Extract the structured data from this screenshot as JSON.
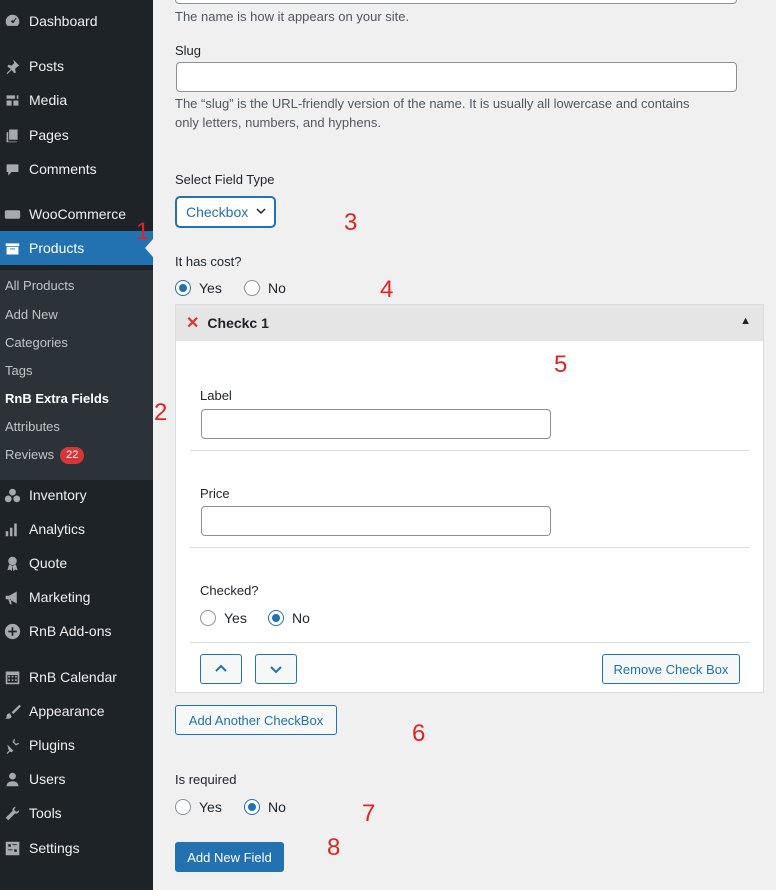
{
  "sidebar": {
    "menu": [
      {
        "label": "Dashboard",
        "icon": "dashboard-icon"
      },
      {
        "label": "Posts",
        "icon": "pin-icon"
      },
      {
        "label": "Media",
        "icon": "media-icon"
      },
      {
        "label": "Pages",
        "icon": "pages-icon"
      },
      {
        "label": "Comments",
        "icon": "comment-icon"
      },
      {
        "label": "WooCommerce",
        "icon": "woo-icon"
      },
      {
        "label": "Products",
        "icon": "archive-icon"
      },
      {
        "label": "Inventory",
        "icon": "inventory-icon"
      },
      {
        "label": "Analytics",
        "icon": "bar-chart-icon"
      },
      {
        "label": "Quote",
        "icon": "award-icon"
      },
      {
        "label": "Marketing",
        "icon": "megaphone-icon"
      },
      {
        "label": "RnB Add-ons",
        "icon": "plus-circle-icon"
      },
      {
        "label": "RnB Calendar",
        "icon": "calendar-icon"
      },
      {
        "label": "Appearance",
        "icon": "brush-icon"
      },
      {
        "label": "Plugins",
        "icon": "plug-icon"
      },
      {
        "label": "Users",
        "icon": "user-icon"
      },
      {
        "label": "Tools",
        "icon": "wrench-icon"
      },
      {
        "label": "Settings",
        "icon": "settings-icon"
      }
    ],
    "submenu": [
      {
        "label": "All Products"
      },
      {
        "label": "Add New"
      },
      {
        "label": "Categories"
      },
      {
        "label": "Tags"
      },
      {
        "label": "RnB Extra Fields"
      },
      {
        "label": "Attributes"
      },
      {
        "label": "Reviews",
        "badge": "22"
      }
    ]
  },
  "form": {
    "name_help": "The name is how it appears on your site.",
    "slug_label": "Slug",
    "slug_value": "",
    "slug_help_1": "The “slug” is the URL-friendly version of the name. It is usually all lowercase and contains",
    "slug_help_2": "only letters, numbers, and hyphens.",
    "field_type_label": "Select Field Type",
    "field_type_value": "Checkbox",
    "cost_label": "It has cost?",
    "cost_yes": "Yes",
    "cost_no": "No",
    "cost_selected": "Yes",
    "checkbox_title": "Checkc 1",
    "checkbox_label_label": "Label",
    "checkbox_label_value": "",
    "price_label": "Price",
    "price_value": "",
    "checked_label": "Checked?",
    "checked_yes": "Yes",
    "checked_no": "No",
    "checked_selected": "No",
    "remove_button": "Remove Check Box",
    "add_another_button": "Add Another CheckBox",
    "required_label": "Is required",
    "required_yes": "Yes",
    "required_no": "No",
    "required_selected": "No",
    "submit_button": "Add New Field"
  },
  "annotations": [
    "1",
    "2",
    "3",
    "4",
    "5",
    "6",
    "7",
    "8"
  ],
  "colors": {
    "accent": "#2271b1",
    "sidebar": "#1d2327",
    "annotation": "#e02424",
    "badge": "#d63638"
  }
}
